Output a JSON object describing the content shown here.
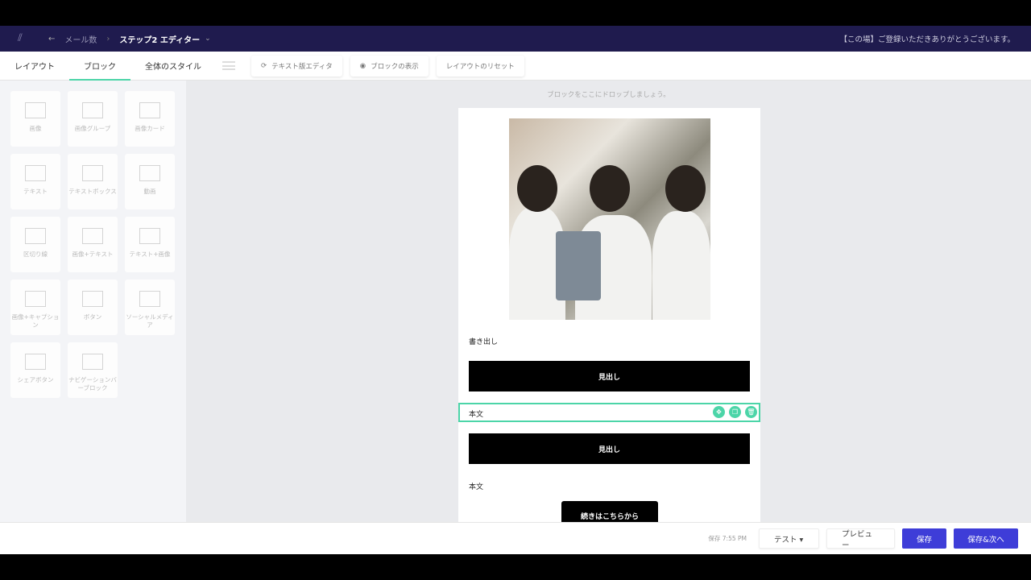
{
  "nav": {
    "back": "←",
    "breadcrumb": "メール数",
    "step": "ステップ2 エディター",
    "subject": "【この場】ご登録いただきありがとうございます。"
  },
  "toolbar": {
    "tabs": [
      "レイアウト",
      "ブロック",
      "全体のスタイル"
    ],
    "text_editor": "テキスト版エディタ",
    "show_blocks": "ブロックの表示",
    "reset_layout": "レイアウトのリセット"
  },
  "blocks": [
    "画像",
    "画像グループ",
    "画像カード",
    "テキスト",
    "テキストボックス",
    "動画",
    "区切り線",
    "画像+テキスト",
    "テキスト+画像",
    "画像+キャプション",
    "ボタン",
    "ソーシャルメディア",
    "シェアボタン",
    "ナビゲーションバーブロック"
  ],
  "canvas": {
    "drop_hint": "ブロックをここにドロップしましょう。",
    "intro": "書き出し",
    "heading1": "見出し",
    "body1": "本文",
    "heading2": "見出し",
    "body2": "本文",
    "cta": "続きはこちらから"
  },
  "footer": {
    "saved": "保存 7:55 PM",
    "test": "テスト ▾",
    "preview": "プレビュー",
    "save": "保存",
    "save_next": "保存&次へ"
  },
  "colors": {
    "nav": "#1f1b4e",
    "accent": "#4cd5a8",
    "primary": "#3e3dd8"
  }
}
